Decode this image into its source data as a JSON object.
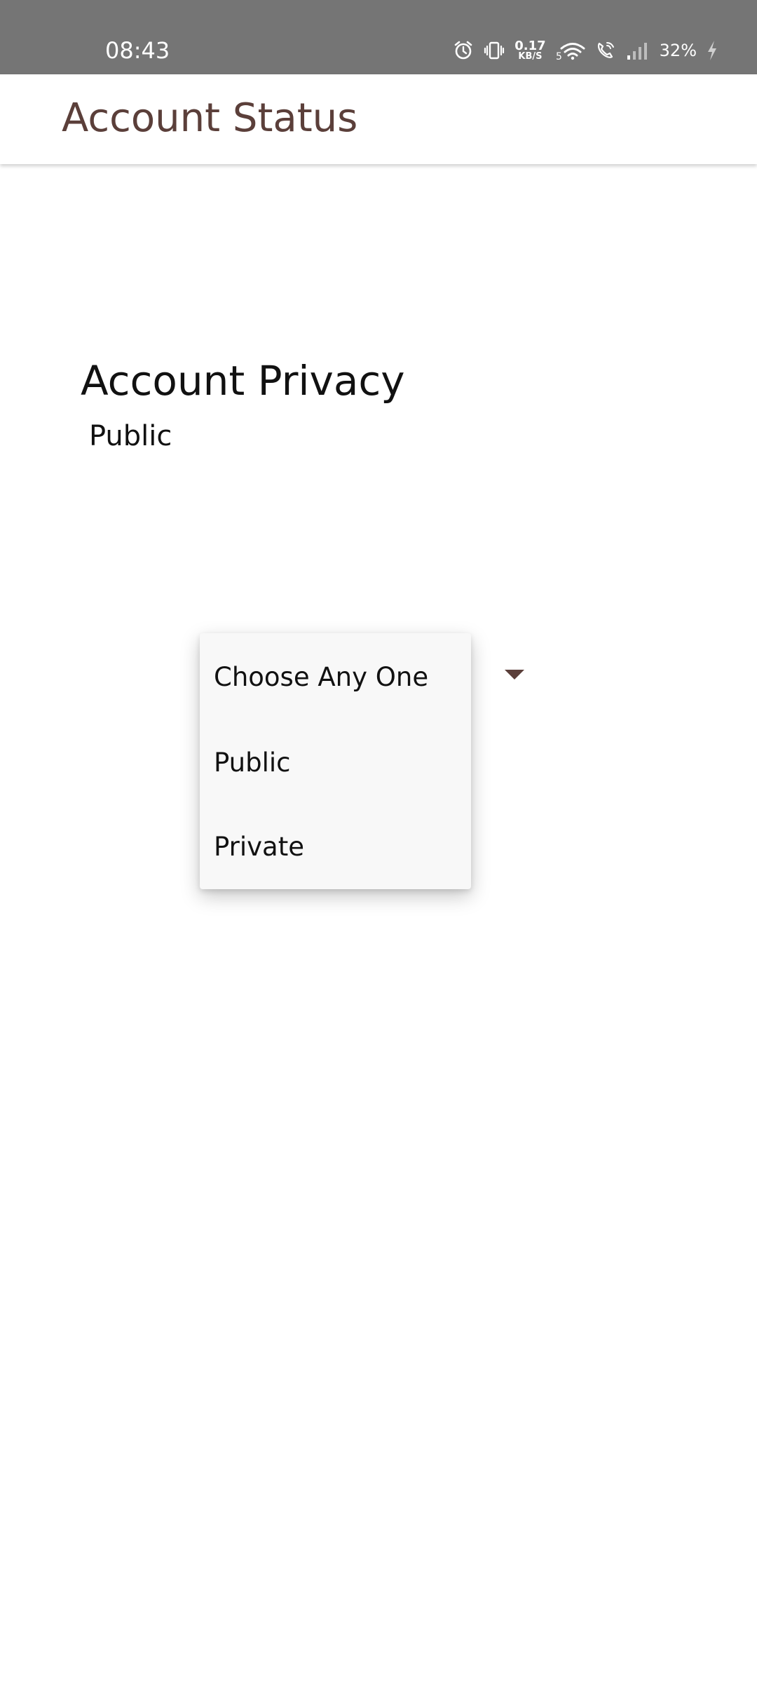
{
  "status_bar": {
    "time": "08:43",
    "net_speed_value": "0.17",
    "net_speed_unit": "KB/S",
    "battery_percent": "32%",
    "icons": [
      "alarm-icon",
      "vibrate-icon",
      "wifi-icon",
      "wifi-calling-icon",
      "cell-signal-icon",
      "charging-icon"
    ]
  },
  "app_bar": {
    "title": "Account Status"
  },
  "privacy": {
    "heading": "Account Privacy",
    "current_value": "Public"
  },
  "dropdown": {
    "options": [
      "Choose Any One",
      "Public",
      "Private"
    ]
  },
  "colors": {
    "accent": "#5b3f3a",
    "status_bar": "#757575"
  }
}
